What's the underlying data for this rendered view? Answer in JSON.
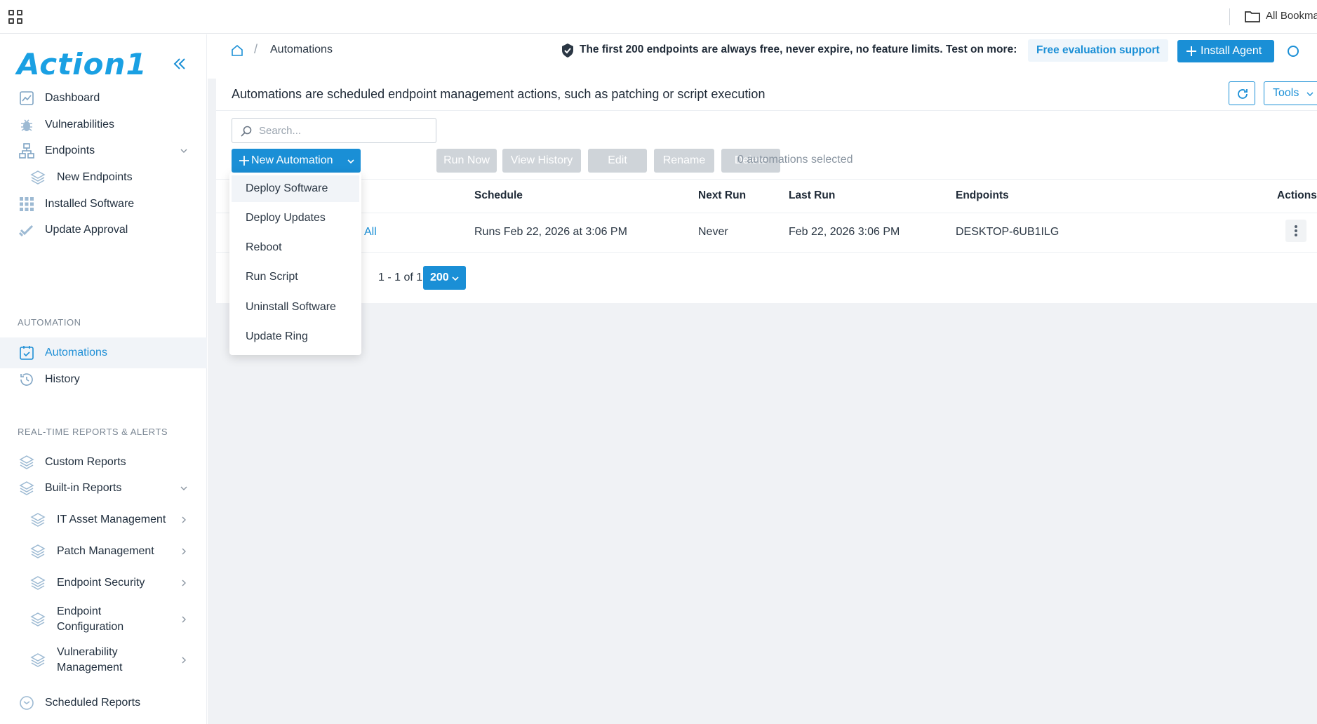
{
  "browser": {
    "bookmarks_label": "All Bookma"
  },
  "sidebar": {
    "logo": "Action1",
    "items": [
      {
        "label": "Dashboard",
        "icon": "chart-icon"
      },
      {
        "label": "Vulnerabilities",
        "icon": "bug-icon"
      },
      {
        "label": "Endpoints",
        "icon": "network-icon"
      },
      {
        "label": "New Endpoints",
        "icon": "layers-icon"
      },
      {
        "label": "Installed Software",
        "icon": "grid-icon"
      },
      {
        "label": "Update Approval",
        "icon": "check-icon"
      }
    ],
    "section_automation": "AUTOMATION",
    "automation_items": [
      {
        "label": "Automations",
        "icon": "calendar-check-icon",
        "active": true
      },
      {
        "label": "History",
        "icon": "history-icon"
      }
    ],
    "section_reports": "REAL-TIME REPORTS & ALERTS",
    "report_items": [
      {
        "label": "Custom Reports",
        "icon": "layers-icon"
      },
      {
        "label": "Built-in Reports",
        "icon": "layers-icon"
      },
      {
        "label": "IT Asset Management",
        "icon": "layers-icon"
      },
      {
        "label": "Patch Management",
        "icon": "layers-icon"
      },
      {
        "label": "Endpoint Security",
        "icon": "layers-icon"
      },
      {
        "label": "Endpoint Configuration",
        "icon": "layers-icon"
      },
      {
        "label": "Vulnerability Management",
        "icon": "layers-icon"
      },
      {
        "label": "Scheduled Reports",
        "icon": "clock-icon"
      }
    ]
  },
  "topbar": {
    "breadcrumb_current": "Automations",
    "breadcrumb_sep": "/",
    "promo": "The first 200 endpoints are always free, never expire, no feature limits. Test on more:",
    "free_eval": "Free evaluation support",
    "install_agent": "Install Agent"
  },
  "panel": {
    "description": "Automations are scheduled endpoint management actions, such as patching or script execution",
    "tools": "Tools",
    "search_placeholder": "Search...",
    "buttons": {
      "new_automation": "New Automation",
      "run_now": "Run Now",
      "view_history": "View History",
      "edit": "Edit",
      "rename": "Rename",
      "delete": "Delete"
    },
    "selected_count": "0 automations selected"
  },
  "table": {
    "headers": {
      "schedule": "Schedule",
      "next_run": "Next Run",
      "last_run": "Last Run",
      "endpoints": "Endpoints",
      "actions": "Actions"
    },
    "rows": [
      {
        "name_partial": "All",
        "schedule": "Runs Feb 22, 2026 at 3:06 PM",
        "next_run": "Never",
        "last_run": "Feb 22, 2026 3:06 PM",
        "endpoints": "DESKTOP-6UB1ILG"
      }
    ],
    "pagination": "1 - 1 of 1",
    "page_size": "200"
  },
  "dropdown": {
    "items": [
      "Deploy Software",
      "Deploy Updates",
      "Reboot",
      "Run Script",
      "Uninstall Software",
      "Update Ring"
    ]
  },
  "colors": {
    "accent": "#1a8fd6",
    "logo": "#1aa0e3",
    "disabled": "#cfd4d9"
  }
}
